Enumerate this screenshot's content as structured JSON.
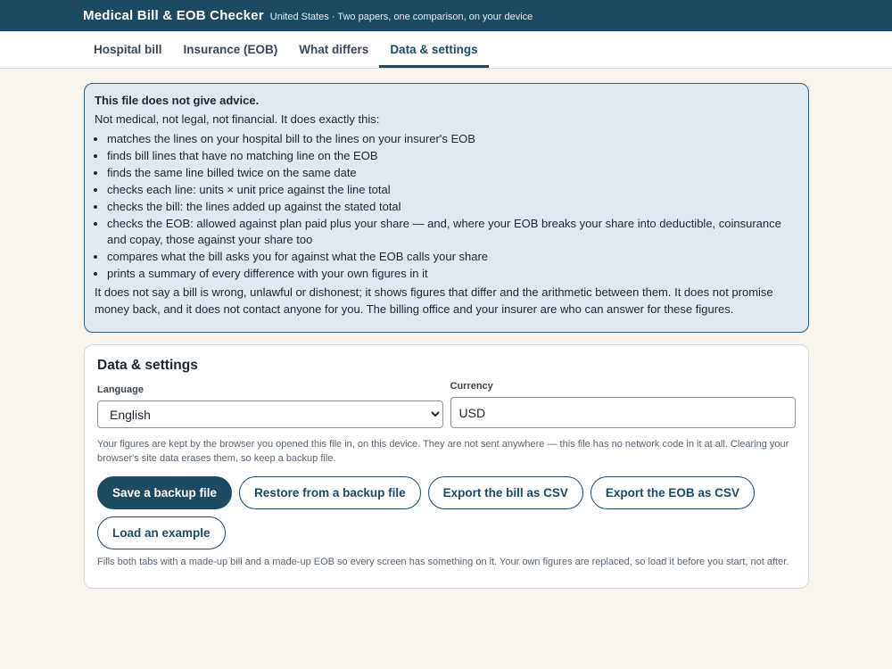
{
  "header": {
    "title": "Medical Bill & EOB Checker",
    "subtitle": "United States · Two papers, one comparison, on your device"
  },
  "tabs": [
    {
      "label": "Hospital bill",
      "active": false
    },
    {
      "label": "Insurance (EOB)",
      "active": false
    },
    {
      "label": "What differs",
      "active": false
    },
    {
      "label": "Data & settings",
      "active": true
    }
  ],
  "notice": {
    "title": "This file does not give advice.",
    "intro": "Not medical, not legal, not financial. It does exactly this:",
    "items": [
      "matches the lines on your hospital bill to the lines on your insurer's EOB",
      "finds bill lines that have no matching line on the EOB",
      "finds the same line billed twice on the same date",
      "checks each line: units × unit price against the line total",
      "checks the bill: the lines added up against the stated total",
      "checks the EOB: allowed against plan paid plus your share — and, where your EOB breaks your share into deductible, coinsurance and copay, those against your share too",
      "compares what the bill asks you for against what the EOB calls your share",
      "prints a summary of every difference with your own figures in it"
    ],
    "outro": "It does not say a bill is wrong, unlawful or dishonest; it shows figures that differ and the arithmetic between them. It does not promise money back, and it does not contact anyone for you. The billing office and your insurer are who can answer for these figures."
  },
  "settings": {
    "heading": "Data & settings",
    "language_label": "Language",
    "language_value": "English",
    "currency_label": "Currency",
    "currency_value": "USD",
    "storage_note": "Your figures are kept by the browser you opened this file in, on this device. They are not sent anywhere — this file has no network code in it at all. Clearing your browser's site data erases them, so keep a backup file.",
    "buttons": {
      "save": "Save a backup file",
      "restore": "Restore from a backup file",
      "export_bill": "Export the bill as CSV",
      "export_eob": "Export the EOB as CSV",
      "load_example": "Load an example"
    },
    "example_note": "Fills both tabs with a made-up bill and a made-up EOB so every screen has something on it. Your own figures are replaced, so load it before you start, not after."
  }
}
